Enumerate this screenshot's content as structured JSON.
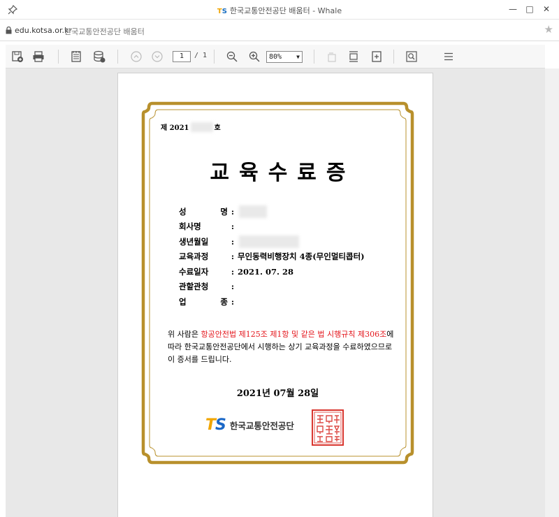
{
  "window": {
    "title": "한국교통안전공단 배움터 - Whale",
    "logo_mark": {
      "t": "T",
      "s": "S"
    }
  },
  "address": {
    "url": "edu.kotsa.or.kr",
    "page_name": "한국교통안전공단 배움터"
  },
  "toolbar": {
    "current_page": "1",
    "total_pages": "/ 1",
    "zoom": "80%"
  },
  "certificate": {
    "number_prefix": "제 2021",
    "number_suffix": "호",
    "title": "교육수료증",
    "fields": [
      {
        "label": "성 명",
        "value": ""
      },
      {
        "label": "회사명",
        "value": ""
      },
      {
        "label": "생년월일",
        "value": ""
      },
      {
        "label": "교육과정",
        "value": "무인동력비행장치 4종(무인멀티콥터)"
      },
      {
        "label": "수료일자",
        "value": "2021. 07. 28"
      },
      {
        "label": "관할관청",
        "value": ""
      },
      {
        "label": "업 종",
        "value": ""
      }
    ],
    "body": {
      "part1": "위 사람은 ",
      "red1": "항공안전법 제125조 제1항 및 같은 법 시행규칙 제306조",
      "part2": "에 따라 한국교통안전공단에서 시행하는 상기 교육과정을 수료하였으므로 이 증서를 드립니다."
    },
    "issue_date": "2021년 07월 28일",
    "issuer_logo": {
      "t": "T",
      "s": "S"
    },
    "issuer_name": "한국교통안전공단",
    "seal_text": "한국교통안전공단이사장인"
  },
  "colors": {
    "frame_gold": "#b8902c",
    "red_text": "#e4151b",
    "seal_red": "#d9362f",
    "logo_orange": "#f0a500",
    "logo_blue": "#1a67c7"
  }
}
